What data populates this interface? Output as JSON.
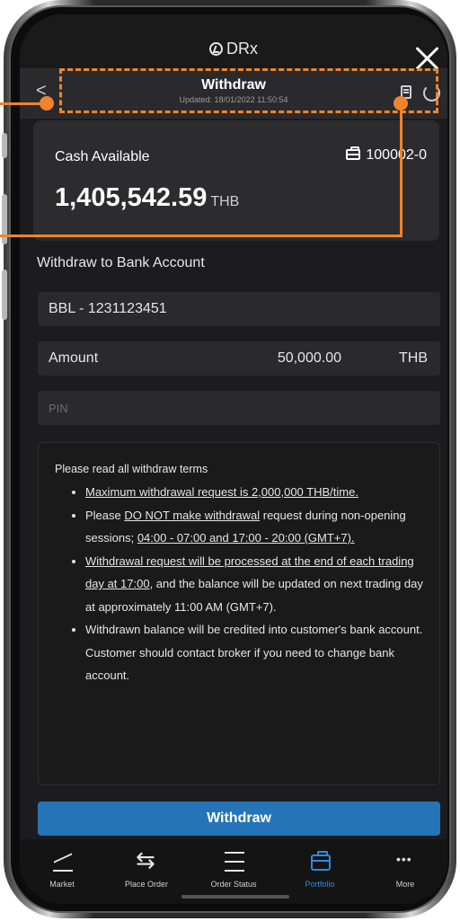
{
  "brand": {
    "name": "DRx"
  },
  "header": {
    "back": "<",
    "title": "Withdraw",
    "updated": "Updated: 18/01/2022 11:50:54"
  },
  "cash": {
    "label": "Cash Available",
    "account": "100002-0",
    "value": "1,405,542.59",
    "currency": "THB"
  },
  "form": {
    "section_title": "Withdraw to Bank Account",
    "bank_account": "BBL - 1231123451",
    "amount_label": "Amount",
    "amount_value": "50,000.00",
    "amount_currency": "THB",
    "pin_placeholder": "PIN"
  },
  "terms": {
    "intro": "Please read all withdraw terms",
    "t1": "Maximum withdrawal request is 2,000,000 THB/time.",
    "t2_a": "Please ",
    "t2_u1": "DO NOT make withdrawal",
    "t2_b": " request during non-opening sessions; ",
    "t2_u2": "04:00 - 07:00 and 17:00 - 20:00 (GMT+7).",
    "t3_u": "Withdrawal request will be processed at the end of each trading day at 17:00",
    "t3_b": ", and the balance will be updated on next trading day at approximately 11:00 AM (GMT+7).",
    "t4": "Withdrawn balance will be credited into customer's bank account. Customer should contact broker if you need to change bank account."
  },
  "withdraw_button": "Withdraw",
  "nav": [
    {
      "label": "Market",
      "icon": "chart-line-icon"
    },
    {
      "label": "Place Order",
      "icon": "swap-arrows-icon"
    },
    {
      "label": "Order Status",
      "icon": "list-icon"
    },
    {
      "label": "Portfolio",
      "icon": "briefcase-icon",
      "active": true
    },
    {
      "label": "More",
      "icon": "more-dots-icon"
    }
  ],
  "colors": {
    "accent": "#2574b8",
    "active_nav": "#2f8ae0",
    "annotation": "#f0842c",
    "background": "#1c1c1e"
  }
}
